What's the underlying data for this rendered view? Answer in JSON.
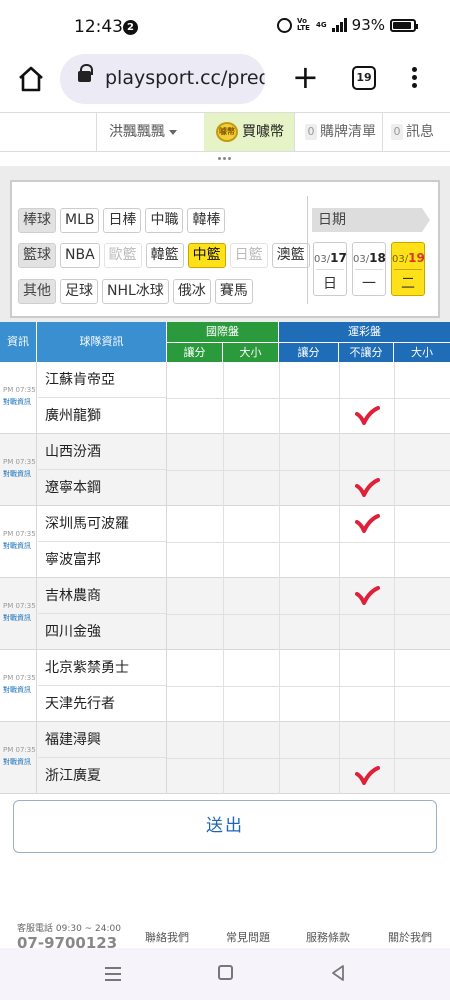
{
  "status_bar": {
    "time": "12:43",
    "notification_count": "2",
    "network": "4G",
    "volte": "Vo LTE",
    "battery": "93%"
  },
  "browser": {
    "url": "playsport.cc/pred",
    "tab_count": "19"
  },
  "site_nav": {
    "username": "洪飄飄飄",
    "buy_coins": "買噱幣",
    "coin_icon_text": "噱幣",
    "cart_count": "0",
    "cart_label": "購牌清單",
    "msg_count": "0",
    "msg_label": "訊息"
  },
  "filter": {
    "baseball": {
      "category": "棒球",
      "leagues": [
        {
          "label": "MLB",
          "state": "normal"
        },
        {
          "label": "日棒",
          "state": "normal"
        },
        {
          "label": "中職",
          "state": "normal"
        },
        {
          "label": "韓棒",
          "state": "normal"
        }
      ]
    },
    "basketball": {
      "category": "籃球",
      "leagues": [
        {
          "label": "NBA",
          "state": "normal"
        },
        {
          "label": "歐籃",
          "state": "disabled"
        },
        {
          "label": "韓籃",
          "state": "normal"
        },
        {
          "label": "中籃",
          "state": "active"
        },
        {
          "label": "日籃",
          "state": "disabled"
        },
        {
          "label": "澳籃",
          "state": "normal"
        }
      ]
    },
    "other": {
      "category": "其他",
      "leagues": [
        {
          "label": "足球",
          "state": "normal"
        },
        {
          "label": "NHL冰球",
          "state": "normal"
        },
        {
          "label": "俄冰",
          "state": "normal"
        },
        {
          "label": "賽馬",
          "state": "normal"
        }
      ]
    },
    "date_label": "日期",
    "dates": [
      {
        "month": "03/",
        "day": "17",
        "weekday": "日",
        "active": false
      },
      {
        "month": "03/",
        "day": "18",
        "weekday": "一",
        "active": false
      },
      {
        "month": "03/",
        "day": "19",
        "weekday": "二",
        "active": true
      }
    ]
  },
  "table": {
    "col_info": "資訊",
    "col_team": "球隊資訊",
    "intl_group": "國際盤",
    "lottery_group": "運彩盤",
    "sub_cols": [
      "讓分",
      "大小",
      "讓分",
      "不讓分",
      "大小"
    ],
    "games": [
      {
        "time": "PM 07:35",
        "versus_link": "對戰資訊",
        "away": "江蘇肯帝亞",
        "home": "廣州龍獅",
        "check_col": 3,
        "check_row": "home"
      },
      {
        "time": "PM 07:35",
        "versus_link": "對戰資訊",
        "away": "山西汾酒",
        "home": "遼寧本鋼",
        "check_col": 3,
        "check_row": "home"
      },
      {
        "time": "PM 07:35",
        "versus_link": "對戰資訊",
        "away": "深圳馬可波羅",
        "home": "寧波富邦",
        "check_col": 3,
        "check_row": "away"
      },
      {
        "time": "PM 07:35",
        "versus_link": "對戰資訊",
        "away": "吉林農商",
        "home": "四川金強",
        "check_col": 3,
        "check_row": "away"
      },
      {
        "time": "PM 07:35",
        "versus_link": "對戰資訊",
        "away": "北京紫禁勇士",
        "home": "天津先行者",
        "check_col": null,
        "check_row": null
      },
      {
        "time": "PM 07:35",
        "versus_link": "對戰資訊",
        "away": "福建潯興",
        "home": "浙江廣夏",
        "check_col": 3,
        "check_row": "home"
      }
    ]
  },
  "submit_label": "送出",
  "footer": {
    "service_hours": "客服電話 09:30 ~ 24:00",
    "phone": "07-9700123",
    "links": [
      "聯絡我們",
      "常見問題",
      "服務條款",
      "關於我們"
    ]
  },
  "colors": {
    "header_blue": "#3a8fd0",
    "intl_green": "#2a9a3c",
    "lottery_blue": "#1f6db7",
    "active_yellow": "#ffe11a",
    "check_red": "#e0203a"
  }
}
